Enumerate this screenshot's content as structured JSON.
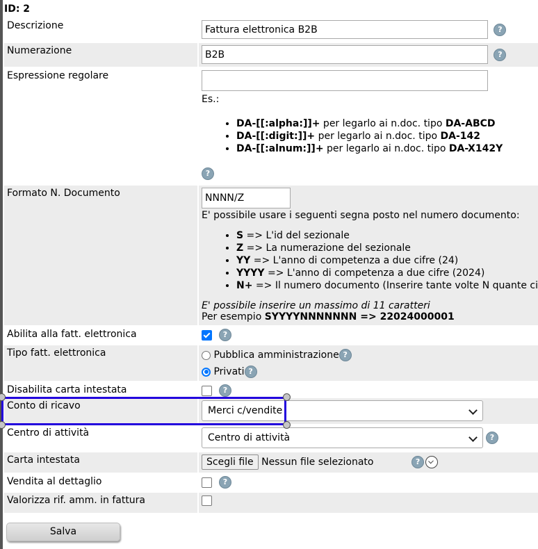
{
  "id_line": "ID: 2",
  "fields": {
    "descrizione": {
      "label": "Descrizione",
      "value": "Fattura elettronica B2B"
    },
    "numerazione": {
      "label": "Numerazione",
      "value": "B2B"
    },
    "espressione": {
      "label": "Espressione regolare",
      "value": "",
      "es": "Es.:",
      "examples": [
        {
          "code": "DA-[[:alpha:]]+",
          "mid": " per legarlo ai n.doc. tipo ",
          "res": "DA-ABCD"
        },
        {
          "code": "DA-[[:digit:]]+",
          "mid": " per legarlo ai n.doc. tipo ",
          "res": "DA-142"
        },
        {
          "code": "DA-[[:alnum:]]+",
          "mid": " per legarlo ai n.doc. tipo ",
          "res": "DA-X142Y"
        }
      ]
    },
    "formato": {
      "label": "Formato N. Documento",
      "value": "NNNN/Z",
      "intro": "E' possibile usare i seguenti segna posto nel numero documento:",
      "placeholders": [
        {
          "key": "S",
          "desc": " => L'id del sezionale"
        },
        {
          "key": "Z",
          "desc": " => La numerazione del sezionale"
        },
        {
          "key": "YY",
          "desc": " => L'anno di competenza a due cifre (24)"
        },
        {
          "key": "YYYY",
          "desc": " => L'anno di competenza a due cifre (2024)"
        },
        {
          "key": "N+",
          "desc": " => Il numero documento (Inserire tante volte N quante ci"
        }
      ],
      "note": "E' possibile inserire un massimo di 11 caratteri",
      "example_prefix": "Per esempio ",
      "example": "SYYYYNNNNNNN => 22024000001"
    },
    "abilita": {
      "label": "Abilita alla fatt. elettronica",
      "checked": true
    },
    "tipo": {
      "label": "Tipo fatt. elettronica",
      "options": [
        "Pubblica amministrazione",
        "Privati"
      ],
      "selected": "Privati"
    },
    "disabilita": {
      "label": "Disabilita carta intestata",
      "checked": false
    },
    "conto": {
      "label": "Conto di ricavo",
      "selected": "Merci c/vendite"
    },
    "centro": {
      "label": "Centro di attività",
      "selected": "Centro di attività"
    },
    "carta": {
      "label": "Carta intestata",
      "button": "Scegli file",
      "status": "Nessun file selezionato"
    },
    "vendita": {
      "label": "Vendita al dettaglio",
      "checked": false
    },
    "valorizza": {
      "label": "Valorizza rif. amm. in fattura",
      "checked": false
    }
  },
  "help_glyph": "?",
  "save_label": "Salva",
  "colors": {
    "highlight": "#2200dd",
    "row_alt": "#ececec",
    "checkbox_on": "#0075ff"
  }
}
